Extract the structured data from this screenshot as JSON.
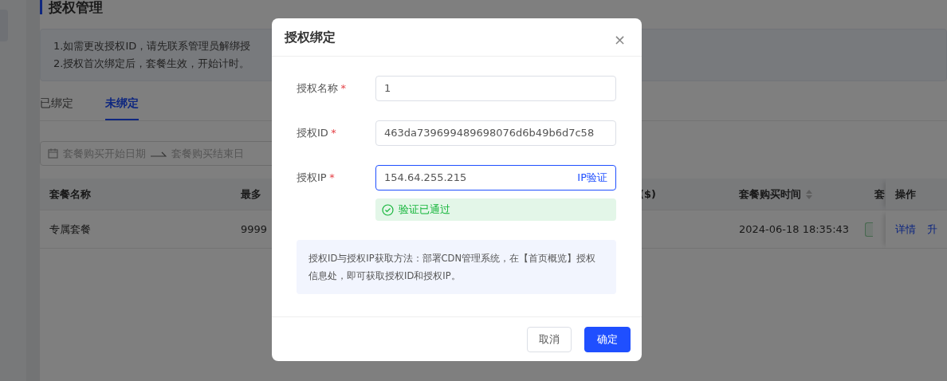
{
  "page": {
    "title": "授权管理",
    "notices": [
      "1.如需更改授权ID，请先联系管理员解绑授",
      "2.授权首次绑定后，套餐生效，开始计时。"
    ]
  },
  "tabs": [
    {
      "label": "已绑定",
      "selected": false
    },
    {
      "label": "未绑定",
      "selected": true
    }
  ],
  "date_range": {
    "start_placeholder": "套餐购买开始日期",
    "end_placeholder": "套餐购买结束日"
  },
  "table": {
    "columns": [
      {
        "label": "套餐名称",
        "sortable": false
      },
      {
        "label": "最多",
        "sortable": false
      },
      {
        "label": "($)",
        "sortable": false
      },
      {
        "label": "套餐购买时间",
        "sortable": true
      },
      {
        "label": "套",
        "sortable": false
      },
      {
        "label": "操作",
        "sortable": false
      }
    ],
    "rows": [
      {
        "name": "专属套餐",
        "max_sites": "9999",
        "purchase_time": "2024-06-18 18:35:43",
        "actions": [
          "详情",
          "升"
        ]
      }
    ]
  },
  "dialog": {
    "title": "授权绑定",
    "close": "×",
    "fields": [
      {
        "label": "授权名称",
        "required_mark": "*",
        "value": "1",
        "focused": false
      },
      {
        "label": "授权ID",
        "required_mark": "*",
        "value": "463da739699489698076d6b49b6d7c58",
        "focused": false
      },
      {
        "label": "授权IP",
        "required_mark": "*",
        "value": "154.64.255.215",
        "focused": true,
        "action": "IP验证"
      }
    ],
    "verification": {
      "text": "验证已通过"
    },
    "note": "授权ID与授权IP获取方法：部署CDN管理系统，在【首页概览】授权信息处，即可获取授权ID和授权IP。",
    "buttons": [
      {
        "label": "取消",
        "kind": "secondary"
      },
      {
        "label": "确定",
        "kind": "primary"
      }
    ]
  }
}
